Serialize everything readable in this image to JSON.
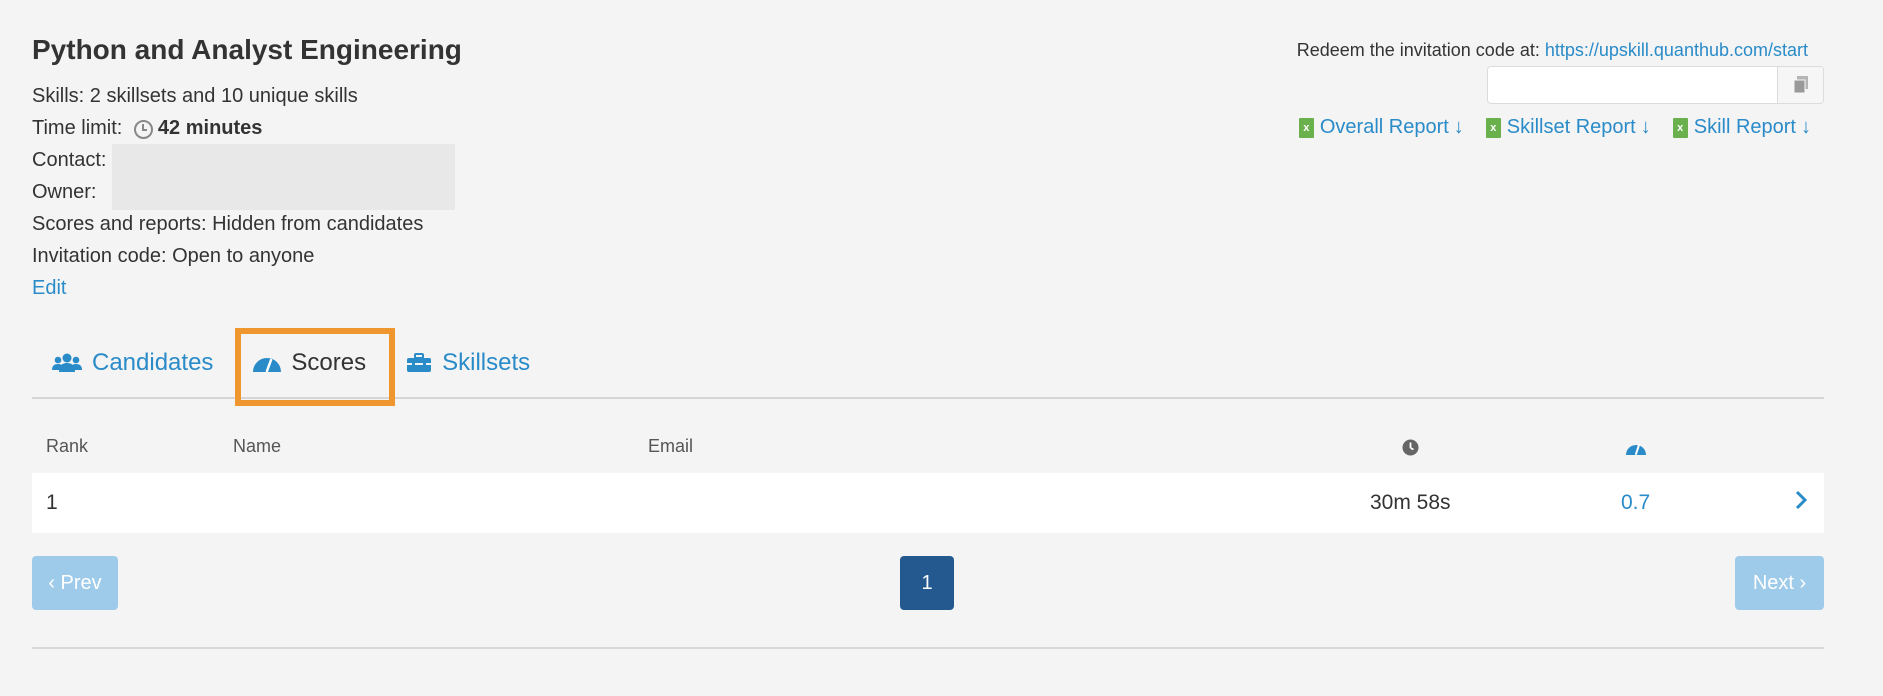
{
  "header": {
    "title": "Python and Analyst Engineering",
    "skills_label": "Skills: ",
    "skills_value": "2 skillsets and 10 unique skills",
    "time_label": "Time limit: ",
    "time_value": "42 minutes",
    "contact_label": "Contact:",
    "owner_label": "Owner:",
    "scores_label": "Scores and reports: ",
    "scores_value": "Hidden from candidates",
    "invitation_label": "Invitation code: ",
    "invitation_value": "Open to anyone",
    "edit_link": "Edit"
  },
  "redeem": {
    "label": "Redeem the invitation code at: ",
    "url": "https://upskill.quanthub.com/start",
    "code_value": ""
  },
  "reports": [
    {
      "label": "Overall Report"
    },
    {
      "label": "Skillset Report"
    },
    {
      "label": "Skill Report"
    }
  ],
  "tabs": [
    {
      "label": "Candidates",
      "icon": "users-icon"
    },
    {
      "label": "Scores",
      "icon": "gauge-icon",
      "active": true
    },
    {
      "label": "Skillsets",
      "icon": "toolbox-icon"
    }
  ],
  "table": {
    "columns": {
      "rank": "Rank",
      "name": "Name",
      "email": "Email",
      "time": "clock-icon",
      "score": "gauge-icon"
    },
    "rows": [
      {
        "rank": "1",
        "name": "",
        "email": "",
        "time": "30m 58s",
        "score": "0.7"
      }
    ]
  },
  "pagination": {
    "prev": "‹ Prev",
    "current": "1",
    "next": "Next ›"
  },
  "colors": {
    "accent": "#2a8bc9",
    "highlight": "#f0962e",
    "page_active": "#23598f",
    "page_disabled": "#9fcbea",
    "excel": "#6ab04c"
  }
}
